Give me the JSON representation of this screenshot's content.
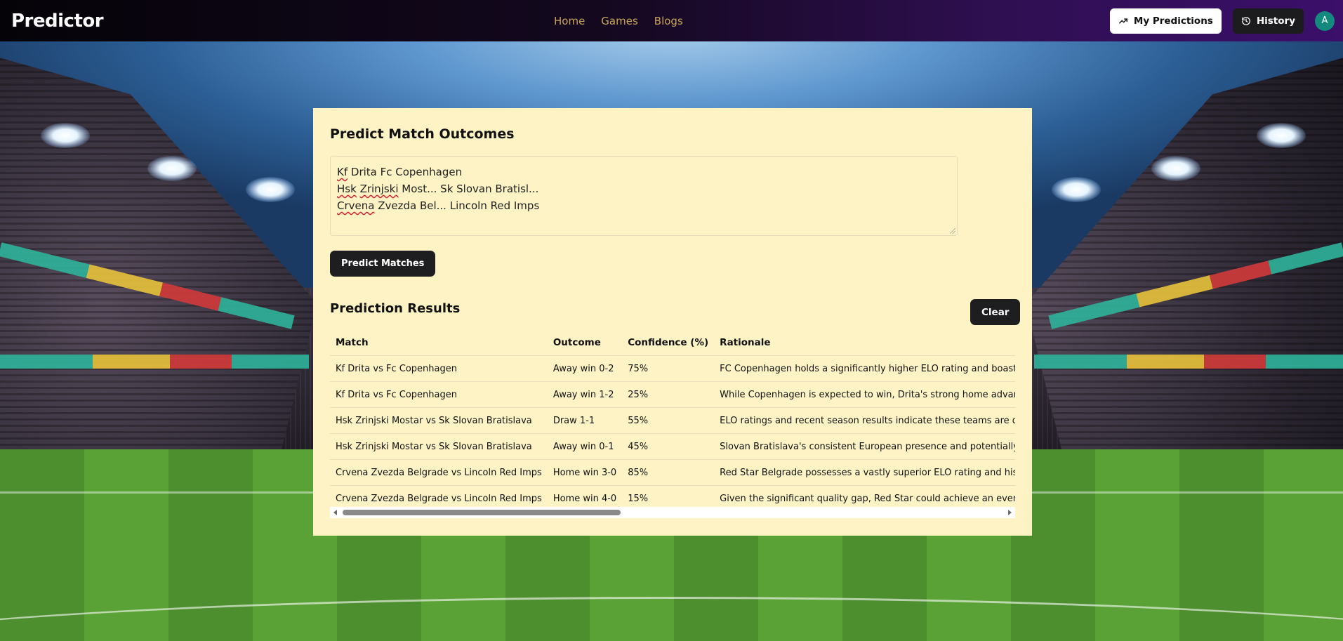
{
  "nav": {
    "brand": "Predictor",
    "links": [
      "Home",
      "Games",
      "Blogs"
    ],
    "my_predictions": "My Predictions",
    "history": "History",
    "avatar_letter": "A"
  },
  "predict": {
    "title": "Predict Match Outcomes",
    "input_lines": [
      "Kf Drita Fc Copenhagen",
      "Hsk Zrinjski Most... Sk Slovan Bratisl...",
      "Crvena Zvezda Bel... Lincoln Red Imps"
    ],
    "button": "Predict Matches"
  },
  "results": {
    "title": "Prediction Results",
    "clear": "Clear",
    "columns": [
      "Match",
      "Outcome",
      "Confidence (%)",
      "Rationale"
    ],
    "rows": [
      {
        "match": "Kf Drita vs Fc Copenhagen",
        "outcome": "Away win 0-2",
        "confidence": "75%",
        "rationale": "FC Copenhagen holds a significantly higher ELO rating and boasts superior"
      },
      {
        "match": "Kf Drita vs Fc Copenhagen",
        "outcome": "Away win 1-2",
        "confidence": "25%",
        "rationale": "While Copenhagen is expected to win, Drita's strong home advantage and"
      },
      {
        "match": "Hsk Zrinjski Mostar vs Sk Slovan Bratislava",
        "outcome": "Draw 1-1",
        "confidence": "55%",
        "rationale": "ELO ratings and recent season results indicate these teams are quite evenly"
      },
      {
        "match": "Hsk Zrinjski Mostar vs Sk Slovan Bratislava",
        "outcome": "Away win 0-1",
        "confidence": "45%",
        "rationale": "Slovan Bratislava's consistent European presence and potentially more disc"
      },
      {
        "match": "Crvena Zvezda Belgrade vs Lincoln Red Imps",
        "outcome": "Home win 3-0",
        "confidence": "85%",
        "rationale": "Red Star Belgrade possesses a vastly superior ELO rating and historical Euro"
      },
      {
        "match": "Crvena Zvezda Belgrade vs Lincoln Red Imps",
        "outcome": "Home win 4-0",
        "confidence": "15%",
        "rationale": "Given the significant quality gap, Red Star could achieve an even larger vict"
      }
    ]
  },
  "colors": {
    "card_bg": "#fef3c5",
    "nav_link": "#c9a45a",
    "button_dark": "#1e1e20",
    "avatar_bg": "#138a7d"
  }
}
